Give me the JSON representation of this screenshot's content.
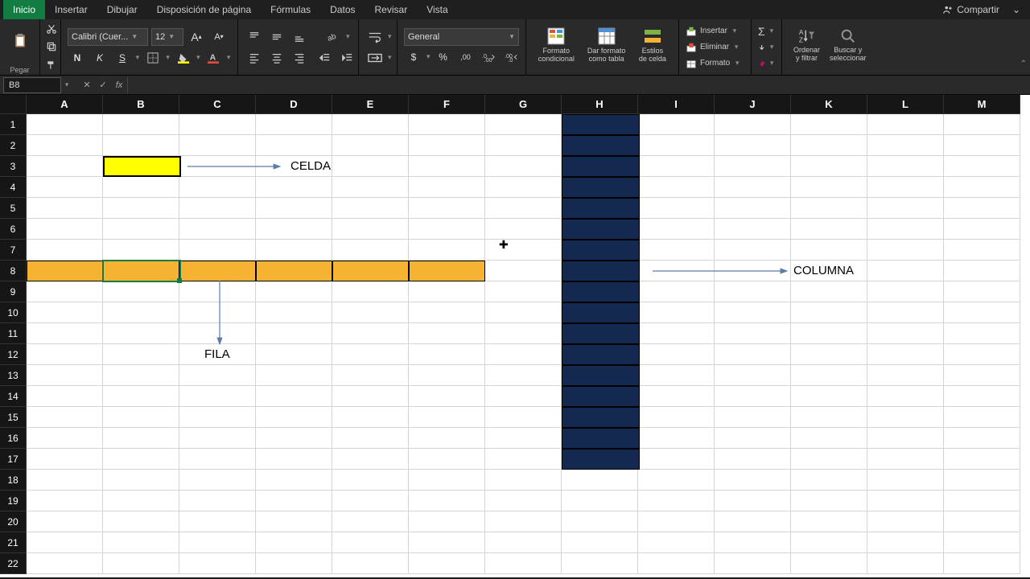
{
  "menu": {
    "tabs": [
      "Inicio",
      "Insertar",
      "Dibujar",
      "Disposición de página",
      "Fórmulas",
      "Datos",
      "Revisar",
      "Vista"
    ],
    "active": 0,
    "share": "Compartir"
  },
  "ribbon": {
    "paste": "Pegar",
    "font": {
      "name": "Calibri (Cuer...",
      "size": "12",
      "bold": "N",
      "italic": "K",
      "underline": "S",
      "inc": "A",
      "dec": "A"
    },
    "number": {
      "format": "General",
      "currency": "$",
      "percent": "%",
      "comma": ",00",
      "inc": ".0",
      "dec": ".00"
    },
    "cond": "Formato condicional",
    "table": "Dar formato como tabla",
    "styles": "Estilos de celda",
    "cells": {
      "insert": "Insertar",
      "delete": "Eliminar",
      "format": "Formato"
    },
    "sort": "Ordenar y filtrar",
    "find": "Buscar y seleccionar"
  },
  "namebox": "B8",
  "fx": "fx",
  "cols": [
    "A",
    "B",
    "C",
    "D",
    "E",
    "F",
    "G",
    "H",
    "I",
    "J",
    "K",
    "L",
    "M"
  ],
  "rows": 22,
  "labels": {
    "celda": "CELDA",
    "fila": "FILA",
    "columna": "COLUMNA"
  }
}
